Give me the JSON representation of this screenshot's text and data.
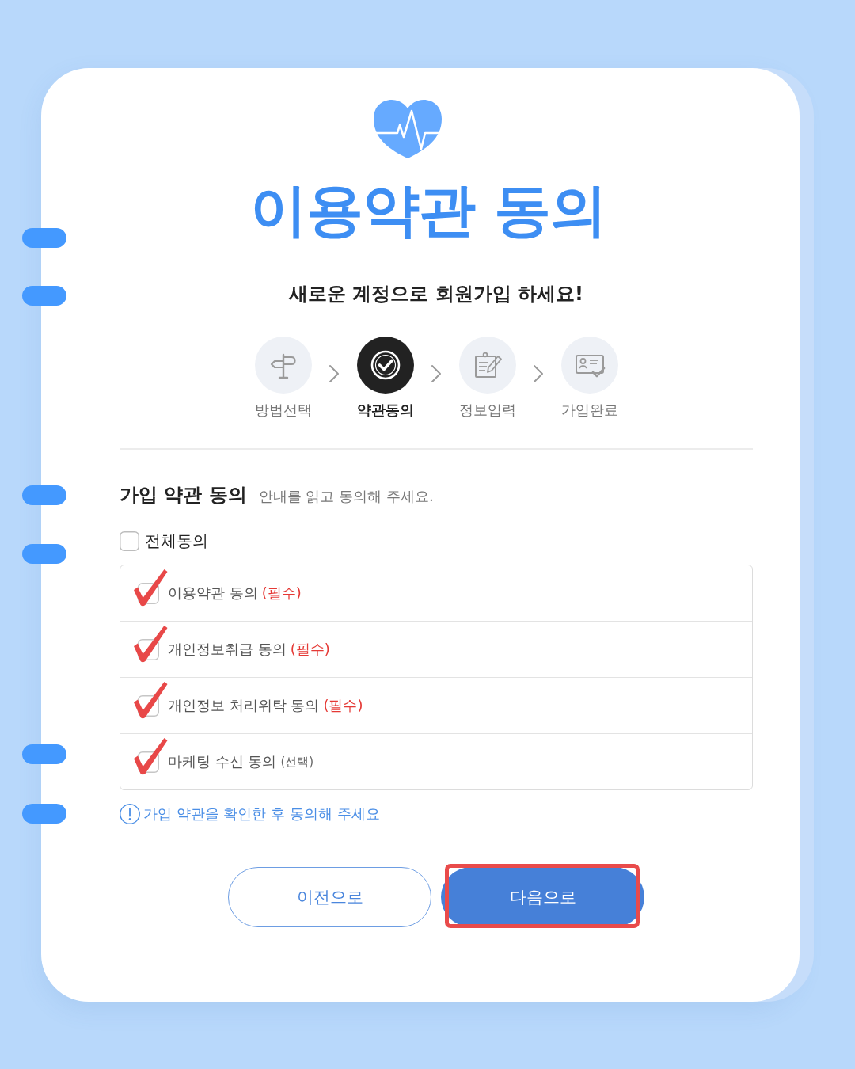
{
  "header": {
    "title": "이용약관 동의",
    "subtitle": "새로운 계정으로 회원가입 하세요!"
  },
  "steps": [
    {
      "label": "방법선택",
      "selected": false
    },
    {
      "label": "약관동의",
      "selected": true
    },
    {
      "label": "정보입력",
      "selected": false
    },
    {
      "label": "가입완료",
      "selected": false
    }
  ],
  "terms": {
    "heading": "가입 약관 동의",
    "hint": "안내를 읽고 동의해 주세요.",
    "agree_all": {
      "label": "전체동의",
      "checked": false
    },
    "items": [
      {
        "label": "이용약관 동의",
        "tag": "(필수)",
        "required": true,
        "checked": true
      },
      {
        "label": "개인정보취급 동의",
        "tag": "(필수)",
        "required": true,
        "checked": true
      },
      {
        "label": "개인정보 처리위탁 동의",
        "tag": "(필수)",
        "required": true,
        "checked": true
      },
      {
        "label": "마케팅 수신 동의",
        "tag": "(선택)",
        "required": false,
        "checked": true
      }
    ]
  },
  "notice": "가입 약관을 확인한 후 동의해 주세요",
  "buttons": [
    {
      "label": "이전으로",
      "kind": "outline",
      "highlighted": false
    },
    {
      "label": "다음으로",
      "kind": "primary",
      "highlighted": true
    }
  ]
}
